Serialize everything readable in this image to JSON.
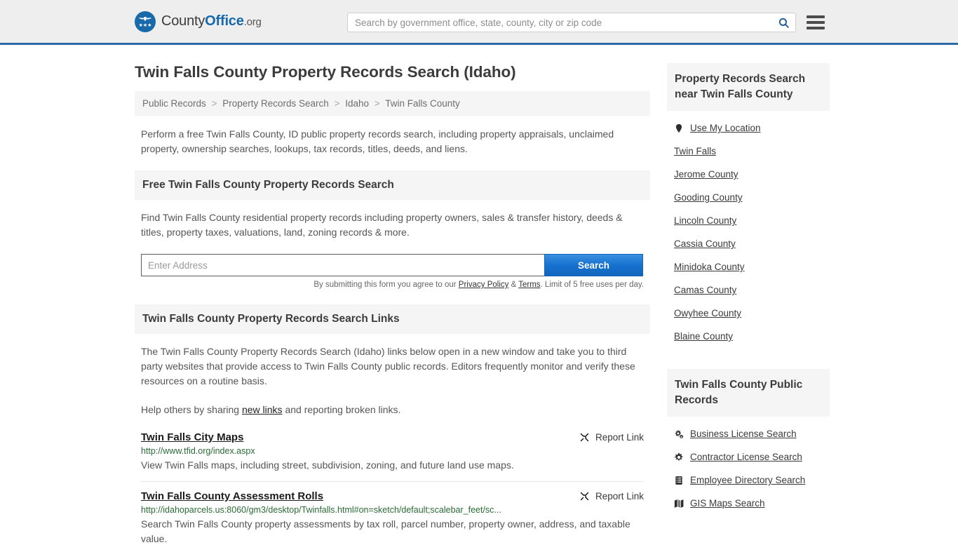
{
  "header": {
    "brand": {
      "part1": "County",
      "part2": "Office",
      "part3": ".org"
    },
    "search_placeholder": "Search by government office, state, county, city or zip code",
    "search_value": "",
    "search_icon": "search-icon",
    "menu_icon": "hamburger-menu-icon"
  },
  "page": {
    "title": "Twin Falls County Property Records Search (Idaho)",
    "breadcrumb": [
      "Public Records",
      "Property Records Search",
      "Idaho",
      "Twin Falls County"
    ],
    "breadcrumb_separator": ">",
    "intro": "Perform a free Twin Falls County, ID public property records search, including property appraisals, unclaimed property, ownership searches, lookups, tax records, titles, deeds, and liens."
  },
  "free_search": {
    "heading": "Free Twin Falls County Property Records Search",
    "description": "Find Twin Falls County residential property records including property owners, sales & transfer history, deeds & titles, property taxes, valuations, land, zoning records & more.",
    "input_placeholder": "Enter Address",
    "input_value": "",
    "button_label": "Search",
    "disclaimer_prefix": "By submitting this form you agree to our ",
    "privacy_label": "Privacy Policy",
    "disclaimer_amp": " & ",
    "terms_label": "Terms",
    "disclaimer_suffix": ". Limit of 5 free uses per day."
  },
  "links_section": {
    "heading": "Twin Falls County Property Records Search Links",
    "paragraph": "The Twin Falls County Property Records Search (Idaho) links below open in a new window and take you to third party websites that provide access to Twin Falls County public records. Editors frequently monitor and verify these resources on a routine basis.",
    "help_prefix": "Help others by sharing ",
    "help_link": "new links",
    "help_suffix": " and reporting broken links.",
    "report_label": "Report Link",
    "report_icon": "broken-link-icon",
    "results": [
      {
        "title": "Twin Falls City Maps",
        "url": "http://www.tfid.org/index.aspx",
        "description": "View Twin Falls maps, including street, subdivision, zoning, and future land use maps."
      },
      {
        "title": "Twin Falls County Assessment Rolls",
        "url": "http://idahoparcels.us:8060/gm3/desktop/Twinfalls.html#on=sketch/default;scalebar_feet/sc...",
        "description": "Search Twin Falls County property assessments by tax roll, parcel number, property owner, address, and taxable value."
      }
    ]
  },
  "sidebar": {
    "nearby": {
      "heading": "Property Records Search near Twin Falls County",
      "items": [
        {
          "label": "Use My Location",
          "icon": "map-pin-icon"
        },
        {
          "label": "Twin Falls",
          "icon": ""
        },
        {
          "label": "Jerome County",
          "icon": ""
        },
        {
          "label": "Gooding County",
          "icon": ""
        },
        {
          "label": "Lincoln County",
          "icon": ""
        },
        {
          "label": "Cassia County",
          "icon": ""
        },
        {
          "label": "Minidoka County",
          "icon": ""
        },
        {
          "label": "Camas County",
          "icon": ""
        },
        {
          "label": "Owyhee County",
          "icon": ""
        },
        {
          "label": "Blaine County",
          "icon": ""
        }
      ]
    },
    "public_records": {
      "heading": "Twin Falls County Public Records",
      "items": [
        {
          "label": "Business License Search",
          "icon": "cogs-icon"
        },
        {
          "label": "Contractor License Search",
          "icon": "gear-icon"
        },
        {
          "label": "Employee Directory Search",
          "icon": "list-book-icon"
        },
        {
          "label": "GIS Maps Search",
          "icon": "map-icon"
        }
      ]
    }
  },
  "colors": {
    "brand_blue": "#1769aa",
    "header_bg": "#eeeeee",
    "header_border": "#2c6ba4",
    "button_blue": "#1672cf",
    "url_green": "#2b6b36",
    "panel_gray": "#f5f5f5"
  }
}
